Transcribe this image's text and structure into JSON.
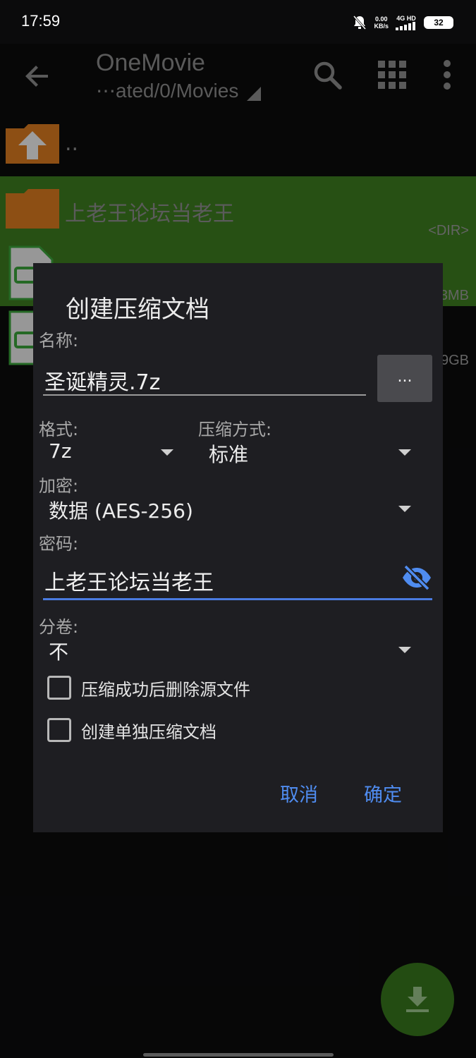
{
  "status": {
    "time": "17:59",
    "net_speed_value": "0.00",
    "net_speed_unit": "KB/s",
    "network": "4G HD",
    "battery": "32"
  },
  "appbar": {
    "title": "OneMovie",
    "path": "⋯ated/0/Movies"
  },
  "files": {
    "up_label": "..",
    "dir_name": "上老王论坛当老王",
    "dir_meta": "<DIR>",
    "file1_size": "3MB",
    "file2_size": "9GB"
  },
  "dialog": {
    "title": "创建压缩文档",
    "name_label": "名称:",
    "name_value": "圣诞精灵.7z",
    "browse_label": "...",
    "format_label": "格式:",
    "format_value": "7z",
    "method_label": "压缩方式:",
    "method_value": "标准",
    "encrypt_label": "加密:",
    "encrypt_value": "数据 (AES-256)",
    "password_label": "密码:",
    "password_value": "上老王论坛当老王",
    "split_label": "分卷:",
    "split_value": "不",
    "delete_source_label": "压缩成功后删除源文件",
    "delete_source_checked": false,
    "separate_archive_label": "创建单独压缩文档",
    "separate_archive_checked": false,
    "cancel_label": "取消",
    "ok_label": "确定"
  },
  "colors": {
    "selected_row": "#3c7b1f",
    "accent": "#4f8cf0",
    "folder": "#d97a1f",
    "fab": "#37751d"
  }
}
